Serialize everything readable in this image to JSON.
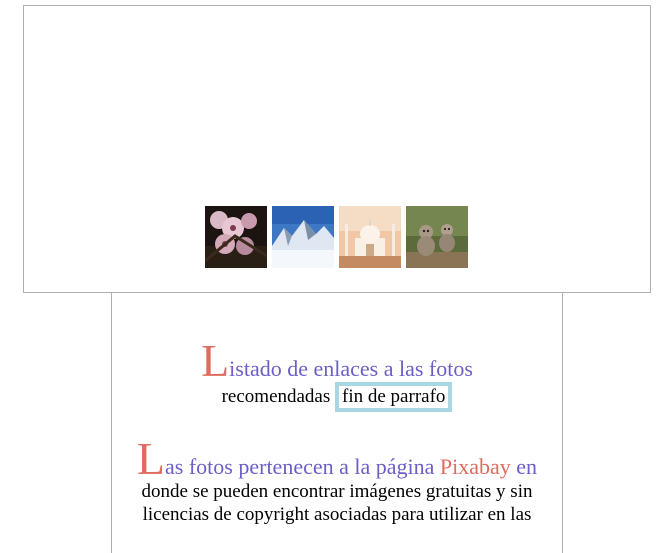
{
  "gallery": {
    "thumbnails": [
      {
        "name": "flowers",
        "icon": "cherry-blossom-image"
      },
      {
        "name": "mountains",
        "icon": "snowy-mountain-image"
      },
      {
        "name": "taj-mahal",
        "icon": "taj-mahal-image"
      },
      {
        "name": "monkeys",
        "icon": "monkeys-image"
      }
    ]
  },
  "paragraph1": {
    "initial": "L",
    "lead_rest": "istado de enlaces a las fotos",
    "line2": "recomendadas",
    "marker": "fin de parrafo"
  },
  "paragraph2": {
    "initial": "L",
    "lead_rest": "as fotos pertenecen a la página ",
    "brand": "Pixabay",
    "lead_end": " en",
    "line2": "donde se pueden encontrar imágenes gratuitas y sin",
    "line3": "licencias de copyright asociadas para utilizar en las"
  },
  "colors": {
    "accent": "#e06b5e",
    "lead_text": "#6a5fc8",
    "marker_border": "#a9d6e2"
  }
}
